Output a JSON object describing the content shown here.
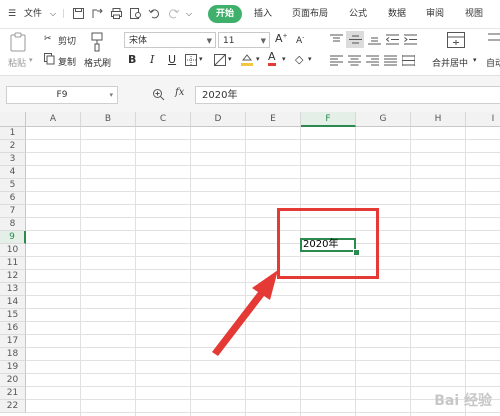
{
  "menu": {
    "file_label": "文件",
    "tabs": [
      {
        "label": "开始",
        "active": true
      },
      {
        "label": "插入"
      },
      {
        "label": "页面布局"
      },
      {
        "label": "公式"
      },
      {
        "label": "数据"
      },
      {
        "label": "审阅"
      },
      {
        "label": "视图"
      }
    ]
  },
  "ribbon": {
    "paste_label": "粘贴",
    "cut_label": "剪切",
    "copy_label": "复制",
    "format_painter_label": "格式刷",
    "font_name": "宋体",
    "font_size": "11",
    "merge_center_label": "合并居中",
    "auto_wrap_label": "自动"
  },
  "formula_bar": {
    "cell_ref": "F9",
    "fx_label": "fx",
    "value": "2020年"
  },
  "sheet": {
    "columns": [
      "A",
      "B",
      "C",
      "D",
      "E",
      "F",
      "G",
      "H",
      "I"
    ],
    "rows": [
      "1",
      "2",
      "3",
      "4",
      "5",
      "6",
      "7",
      "8",
      "9",
      "10",
      "11",
      "12",
      "13",
      "14",
      "15",
      "16",
      "17",
      "18",
      "19",
      "20",
      "21",
      "22"
    ],
    "active_column": "F",
    "active_row": "9",
    "active_cell_value": "2020年"
  },
  "annotation": {
    "highlight_color": "#e53935"
  },
  "watermark": "Bai 经验",
  "colors": {
    "accent": "#3eb06b",
    "selection": "#2d8a4e"
  }
}
